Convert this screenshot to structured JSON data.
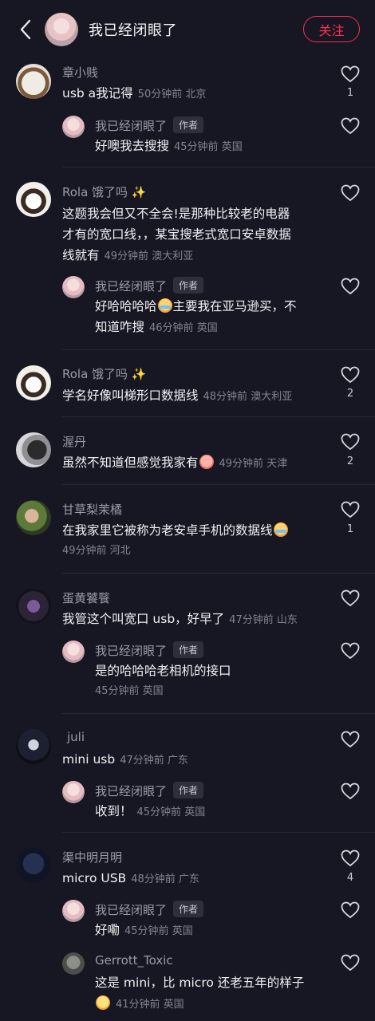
{
  "header": {
    "title": "我已经闭眼了",
    "follow_label": "关注"
  },
  "author_badge": "作者",
  "comments": [
    {
      "user": "章小贱",
      "text": "usb a我记得",
      "meta": "50分钟前 北京",
      "likes": "1",
      "reply": {
        "user": "我已经闭眼了",
        "text": "好噢我去搜搜",
        "meta": "45分钟前 英国"
      }
    },
    {
      "user": "Rola 饿了吗",
      "text_lines": [
        "这题我会但又不全会!是那种比较老的电器",
        "才有的宽口线，，某宝搜老式宽口安卓数据",
        "线就有"
      ],
      "meta": "49分钟前 澳大利亚",
      "reply": {
        "user": "我已经闭眼了",
        "text_a": "好哈哈哈哈",
        "text_b": "主要我在亚马逊买，不",
        "text_line2": "知道咋搜",
        "meta": "46分钟前 英国"
      }
    },
    {
      "user": "Rola 饿了吗",
      "text": "学名好像叫梯形口数据线",
      "meta": "48分钟前 澳大利亚",
      "likes": "2"
    },
    {
      "user": "渥丹",
      "text": "虽然不知道但感觉我家有",
      "meta": "49分钟前 天津",
      "likes": "2"
    },
    {
      "user": "甘草梨茉橘",
      "text": "在我家里它被称为老安卓手机的数据线",
      "meta": "49分钟前 河北",
      "likes": "1"
    },
    {
      "user": "蛋黄饕餮",
      "text": "我管这个叫宽口 usb，好早了",
      "meta": "47分钟前 山东",
      "reply": {
        "user": "我已经闭眼了",
        "text": "是的哈哈哈老相机的接口",
        "meta": "45分钟前 英国"
      }
    },
    {
      "user": "juli",
      "text": "mini usb",
      "meta": "47分钟前 广东",
      "reply": {
        "user": "我已经闭眼了",
        "text": "收到！",
        "meta": "45分钟前 英国"
      }
    },
    {
      "user": "渠中明月明",
      "text": "micro USB",
      "meta": "48分钟前 广东",
      "likes": "4",
      "reply": {
        "user": "我已经闭眼了",
        "text": "好嘞",
        "meta": "45分钟前 英国"
      },
      "reply2": {
        "user": "Gerrott_Toxic",
        "text": "这是 mini，比 micro 还老五年的样子",
        "meta": "41分钟前 英国"
      }
    }
  ]
}
